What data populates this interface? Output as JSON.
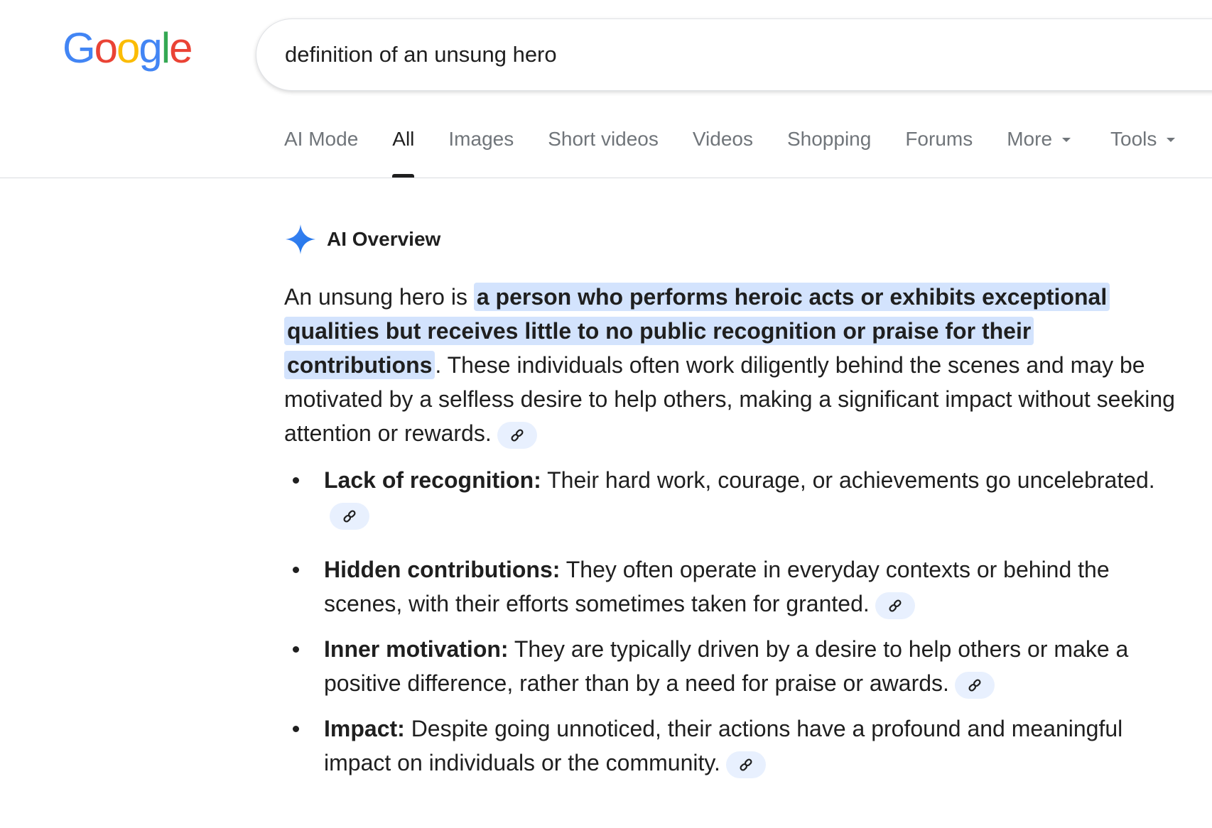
{
  "logo": {
    "text": "Google",
    "letters": [
      {
        "char": "G",
        "color": "#4285F4"
      },
      {
        "char": "o",
        "color": "#EA4335"
      },
      {
        "char": "o",
        "color": "#FBBC05"
      },
      {
        "char": "g",
        "color": "#4285F4"
      },
      {
        "char": "l",
        "color": "#34A853"
      },
      {
        "char": "e",
        "color": "#EA4335"
      }
    ]
  },
  "search": {
    "query": "definition of an unsung hero"
  },
  "tabs": [
    {
      "label": "AI Mode",
      "active": false
    },
    {
      "label": "All",
      "active": true
    },
    {
      "label": "Images",
      "active": false
    },
    {
      "label": "Short videos",
      "active": false
    },
    {
      "label": "Videos",
      "active": false
    },
    {
      "label": "Shopping",
      "active": false
    },
    {
      "label": "Forums",
      "active": false
    },
    {
      "label": "More",
      "active": false,
      "icon": "caret-down-icon"
    },
    {
      "label": "Tools",
      "active": false,
      "icon": "caret-down-icon"
    }
  ],
  "ai_overview": {
    "title": "AI Overview",
    "icon": "sparkle-icon",
    "accent_color": "#4285F4",
    "highlight_color": "#d3e3fd",
    "intro_prefix": "An unsung hero is ",
    "intro_highlight": "a person who performs heroic acts or exhibits exceptional qualities but receives little to no public recognition or praise for their contributions",
    "intro_suffix": ". These individuals often work diligently behind the scenes and may be motivated by a selfless desire to help others, making a significant impact without seeking attention or rewards.",
    "bullets": [
      {
        "term": "Lack of recognition:",
        "text": " Their hard work, courage, or achievements go uncelebrated."
      },
      {
        "term": "Hidden contributions:",
        "text": " They often operate in everyday contexts or behind the scenes, with their efforts sometimes taken for granted."
      },
      {
        "term": "Inner motivation:",
        "text": " They are typically driven by a desire to help others or make a positive difference, rather than by a need for praise or awards."
      },
      {
        "term": "Impact:",
        "text": " Despite going unnoticed, their actions have a profound and meaningful impact on individuals or the community."
      }
    ],
    "link_icon": "link-icon"
  }
}
